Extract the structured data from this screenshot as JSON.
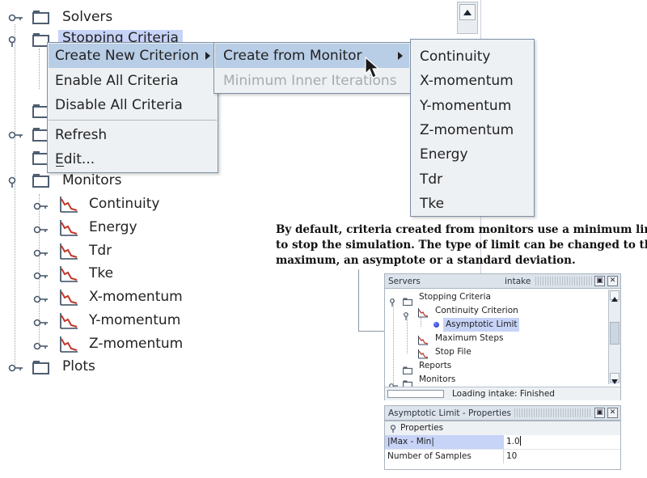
{
  "tree": {
    "items": [
      {
        "id": "solvers",
        "label": "Solvers"
      },
      {
        "id": "stopping-criteria",
        "label": "Stopping Criteria"
      },
      {
        "id": "monitors",
        "label": "Monitors"
      },
      {
        "id": "plots",
        "label": "Plots"
      }
    ],
    "monitors": [
      {
        "label": "Continuity"
      },
      {
        "label": "Energy"
      },
      {
        "label": "Tdr"
      },
      {
        "label": "Tke"
      },
      {
        "label": "X-momentum"
      },
      {
        "label": "Y-momentum"
      },
      {
        "label": "Z-momentum"
      }
    ]
  },
  "context_menu": {
    "items": [
      {
        "label": "Create New Criterion",
        "state": "highlighted",
        "submenu": true
      },
      {
        "label": "Enable All Criteria"
      },
      {
        "label": "Disable All Criteria"
      },
      {
        "label": "Refresh"
      },
      {
        "label": "Edit...",
        "mnemonic": "E"
      }
    ]
  },
  "submenu": {
    "items": [
      {
        "label": "Create from Monitor",
        "state": "highlighted",
        "submenu": true
      },
      {
        "label": "Minimum Inner Iterations",
        "state": "disabled"
      }
    ]
  },
  "monitor_menu": {
    "items": [
      "Continuity",
      "X-momentum",
      "Y-momentum",
      "Z-momentum",
      "Energy",
      "Tdr",
      "Tke"
    ]
  },
  "caption": {
    "lines": [
      "By default, criteria created from monitors use a minimum limit",
      "to stop the simulation. The type of limit can be changed to the",
      "maximum, an asymptote or a standard deviation."
    ]
  },
  "servers_window": {
    "title": "Servers",
    "context": "intake",
    "tree": [
      {
        "label": "Stopping Criteria"
      },
      {
        "label": "Continuity Criterion"
      },
      {
        "label": "Asymptotic Limit",
        "selected": true
      },
      {
        "label": "Maximum Steps"
      },
      {
        "label": "Stop File"
      },
      {
        "label": "Reports"
      },
      {
        "label": "Monitors"
      }
    ],
    "status": "Loading intake: Finished"
  },
  "properties_window": {
    "title": "Asymptotic Limit - Properties",
    "group": "Properties",
    "rows": [
      {
        "name": "|Max - Min|",
        "value": "1.0"
      },
      {
        "name": "Number of Samples",
        "value": "10"
      }
    ]
  },
  "colors": {
    "menu_highlight": "#b8cde6",
    "menu_bg": "#eef1f4",
    "folder": "#4f5e70",
    "monitor_icon": "#c0392b",
    "selection": "#c7d3f7"
  }
}
